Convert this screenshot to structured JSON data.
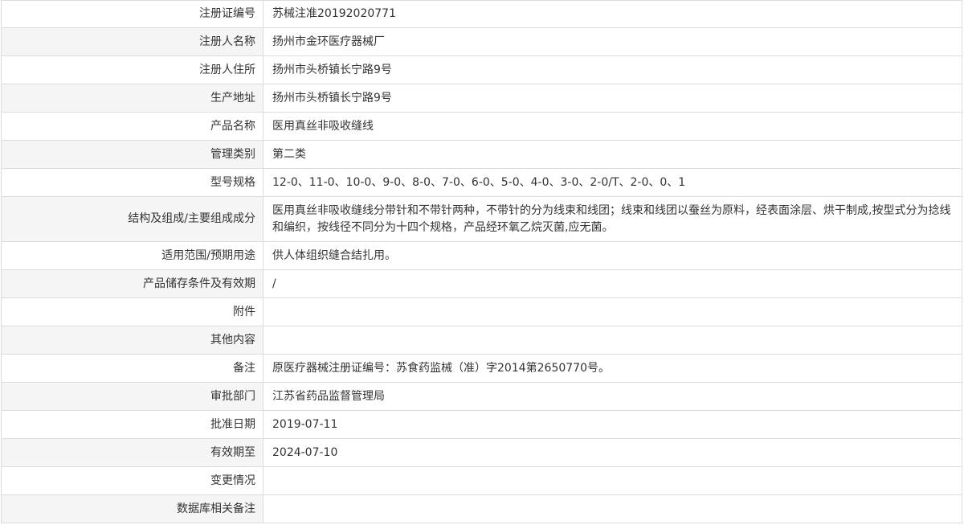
{
  "rows": [
    {
      "label": "注册证编号",
      "value": "苏械注准20192020771"
    },
    {
      "label": "注册人名称",
      "value": "扬州市金环医疗器械厂"
    },
    {
      "label": "注册人住所",
      "value": "扬州市头桥镇长宁路9号"
    },
    {
      "label": "生产地址",
      "value": "扬州市头桥镇长宁路9号"
    },
    {
      "label": "产品名称",
      "value": "医用真丝非吸收缝线"
    },
    {
      "label": "管理类别",
      "value": "第二类"
    },
    {
      "label": "型号规格",
      "value": "12-0、11-0、10-0、9-0、8-0、7-0、6-0、5-0、4-0、3-0、2-0/T、2-0、0、1"
    },
    {
      "label": "结构及组成/主要组成成分",
      "value": "医用真丝非吸收缝线分带针和不带针两种，不带针的分为线束和线团；线束和线团以蚕丝为原料，经表面涂层、烘干制成,按型式分为捻线和编织，按线径不同分为十四个规格，产品经环氧乙烷灭菌,应无菌。"
    },
    {
      "label": "适用范围/预期用途",
      "value": "供人体组织缝合结扎用。"
    },
    {
      "label": "产品储存条件及有效期",
      "value": "/"
    },
    {
      "label": "附件",
      "value": ""
    },
    {
      "label": "其他内容",
      "value": ""
    },
    {
      "label": "备注",
      "value": "原医疗器械注册证编号：苏食药监械（准）字2014第2650770号。"
    },
    {
      "label": "审批部门",
      "value": "江苏省药品监督管理局"
    },
    {
      "label": "批准日期",
      "value": "2019-07-11"
    },
    {
      "label": "有效期至",
      "value": "2024-07-10"
    },
    {
      "label": "变更情况",
      "value": ""
    },
    {
      "label": "数据库相关备注",
      "value": ""
    }
  ]
}
